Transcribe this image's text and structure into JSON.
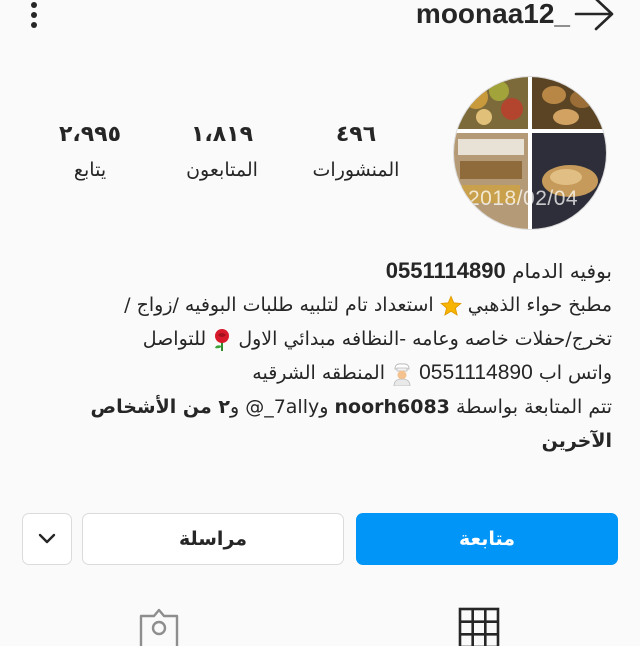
{
  "header": {
    "username": "moonaa12_",
    "menu_icon": "more-vertical-icon",
    "back_icon": "arrow-right-icon"
  },
  "profile": {
    "avatar_date": "2018/02/04",
    "stats": {
      "posts": {
        "value": "٤٩٦",
        "label": "المنشورات"
      },
      "followers": {
        "value": "١،٨١٩",
        "label": "المتابعون"
      },
      "following": {
        "value": "٢،٩٩٥",
        "label": "يتابع"
      }
    }
  },
  "bio": {
    "name_text": "بوفيه الدمام",
    "name_phone": "0551114890",
    "line1_a": "مطبخ حواء الذهبي",
    "line1_b": "استعداد تام لتلبيه طلبات البوفيه /زواج /",
    "line2": "تخرج/حفلات خاصه وعامه -النظافه مبدائي الاول",
    "line2_end": "للتواصل",
    "line3_a": "واتس اب",
    "line3_phone": "0551114890",
    "line3_b": "المنطقه الشرقيه",
    "followed_prefix": "تتم المتابعة بواسطة",
    "followed_user1": "noorh6083",
    "followed_and": "و",
    "followed_user2": "@_7ally",
    "followed_and2": "و",
    "followed_others": "٢ من الأشخاص",
    "followed_others2": "الآخرين"
  },
  "actions": {
    "follow_label": "متابعة",
    "message_label": "مراسلة"
  },
  "colors": {
    "accent": "#0095f6",
    "text": "#262626",
    "border": "#dbdbdb",
    "background": "#fafafa"
  },
  "tabs": [
    {
      "icon": "grid-icon"
    },
    {
      "icon": "tagged-user-icon"
    }
  ]
}
